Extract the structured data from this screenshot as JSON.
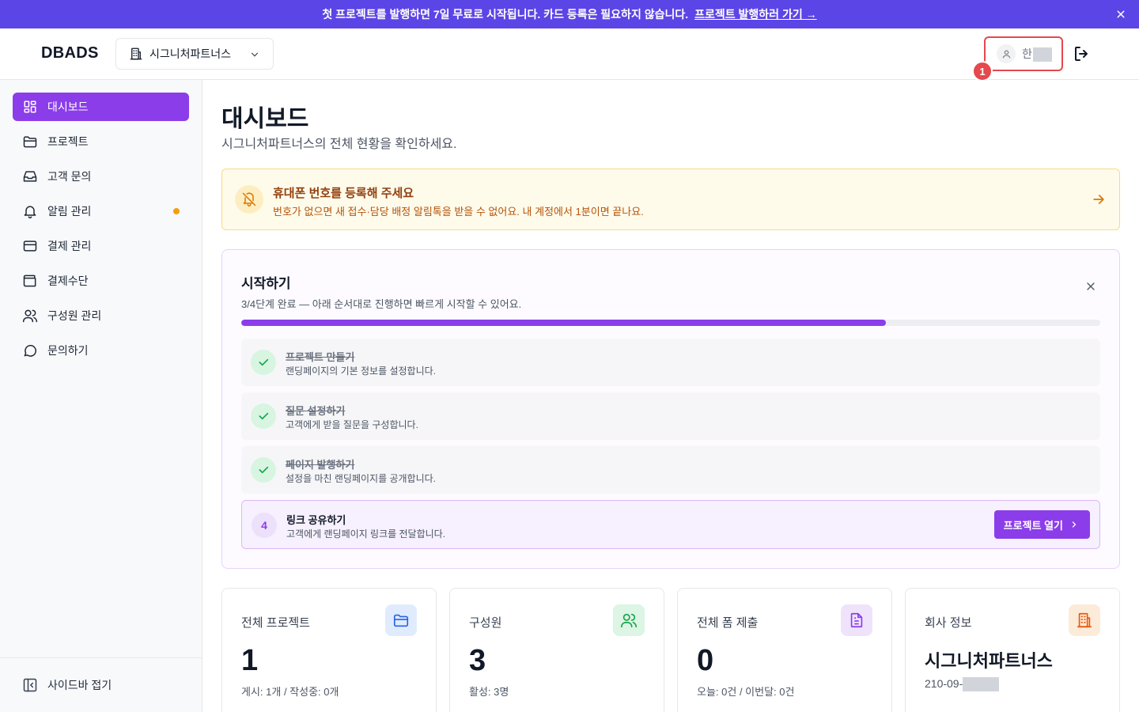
{
  "banner": {
    "text": "첫 프로젝트를 발행하면 7일 무료로 시작됩니다. 카드 등록은 필요하지 않습니다.",
    "link": "프로젝트 발행하러 가기 →"
  },
  "header": {
    "logo": "DBADS",
    "org_name": "시그니처파트너스",
    "user_name": "한",
    "annotation_badge": "1"
  },
  "sidebar": {
    "items": [
      {
        "label": "대시보드",
        "icon": "grid-icon",
        "active": true
      },
      {
        "label": "프로젝트",
        "icon": "folder-icon"
      },
      {
        "label": "고객 문의",
        "icon": "inbox-icon"
      },
      {
        "label": "알림 관리",
        "icon": "bell-icon",
        "dot": true
      },
      {
        "label": "결제 관리",
        "icon": "credit-card-icon"
      },
      {
        "label": "결제수단",
        "icon": "wallet-icon"
      },
      {
        "label": "구성원 관리",
        "icon": "users-icon"
      },
      {
        "label": "문의하기",
        "icon": "chat-icon"
      }
    ],
    "collapse_label": "사이드바 접기"
  },
  "main": {
    "title": "대시보드",
    "subtitle": "시그니처파트너스의 전체 현황을 확인하세요.",
    "alert": {
      "title": "휴대폰 번호를 등록해 주세요",
      "desc": "번호가 없으면 새 접수·담당 배정 알림톡을 받을 수 없어요. 내 계정에서 1분이면 끝나요."
    },
    "getting_started": {
      "title": "시작하기",
      "subtitle": "3/4단계 완료 — 아래 순서대로 진행하면 빠르게 시작할 수 있어요.",
      "progress": 0.75,
      "steps": [
        {
          "title": "프로젝트 만들기",
          "desc": "랜딩페이지의 기본 정보를 설정합니다.",
          "done": true
        },
        {
          "title": "질문 설정하기",
          "desc": "고객에게 받을 질문을 구성합니다.",
          "done": true
        },
        {
          "title": "페이지 발행하기",
          "desc": "설정을 마친 랜딩페이지를 공개합니다.",
          "done": true
        },
        {
          "number": "4",
          "title": "링크 공유하기",
          "desc": "고객에게 랜딩페이지 링크를 전달합니다.",
          "done": false,
          "button": "프로젝트 열기"
        }
      ]
    },
    "stats": [
      {
        "label": "전체 프로젝트",
        "value": "1",
        "desc": "게시: 1개 / 작성중: 0개",
        "icon": "folder-icon",
        "color": "#2563eb",
        "bg": "#e0ecfd"
      },
      {
        "label": "구성원",
        "value": "3",
        "desc": "활성: 3명",
        "icon": "users-icon",
        "color": "#16a34a",
        "bg": "#dcf5e4"
      },
      {
        "label": "전체 폼 제출",
        "value": "0",
        "desc": "오늘: 0건 / 이번달: 0건",
        "icon": "document-icon",
        "color": "#8b3dea",
        "bg": "#efe3fc"
      },
      {
        "label": "회사 정보",
        "value": "시그니처파트너스",
        "desc": "210-09-",
        "icon": "building-icon",
        "color": "#ea580c",
        "bg": "#fdebd9"
      }
    ]
  },
  "colors": {
    "accent": "#8b3dea",
    "banner": "#5b45e6",
    "annotation": "#e5484d"
  }
}
